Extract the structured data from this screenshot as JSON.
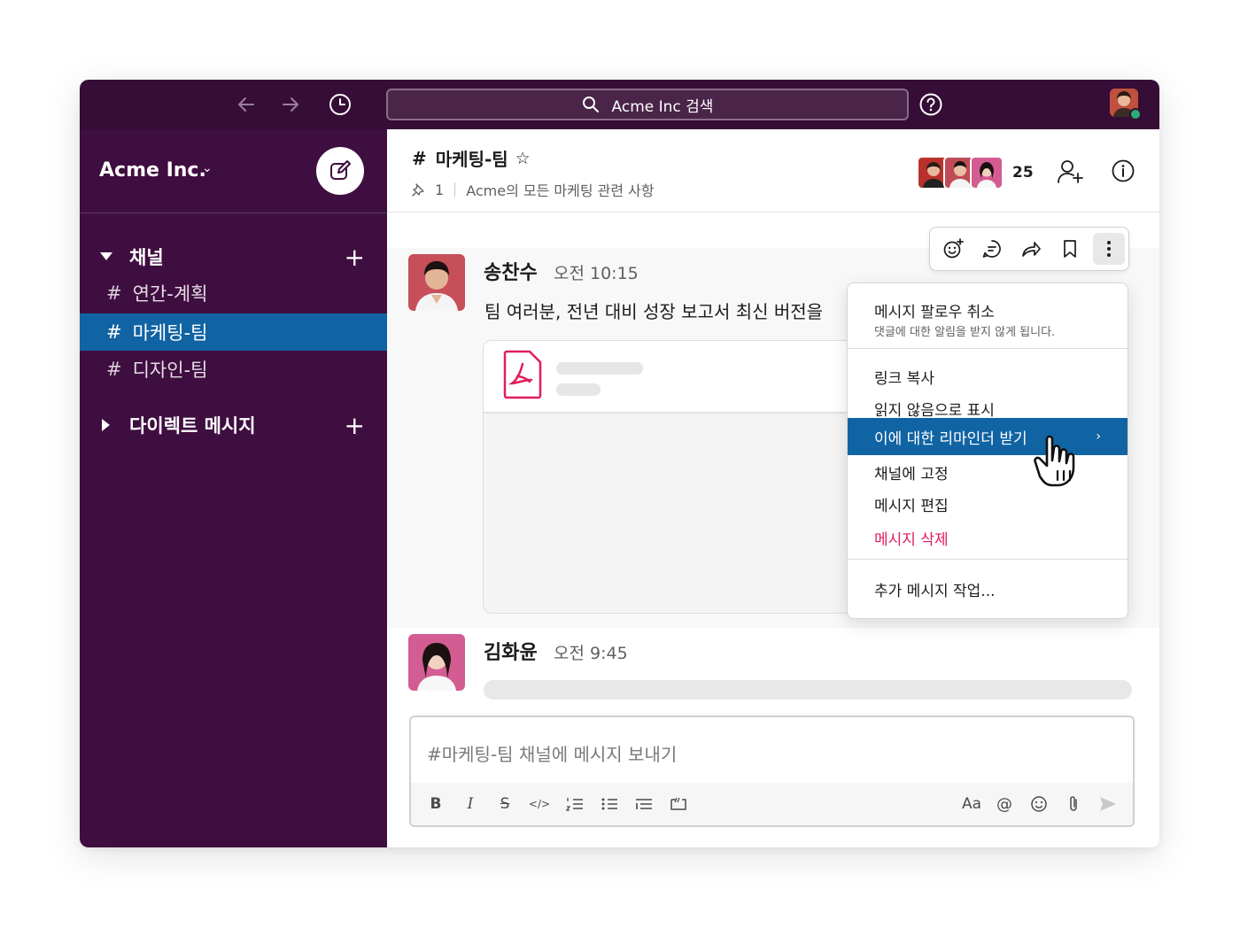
{
  "topbar": {
    "search_text": "Acme Inc 검색",
    "back_icon": "arrow-left-icon",
    "forward_icon": "arrow-right-icon",
    "history_icon": "clock-icon",
    "help_icon": "question-icon",
    "presence_color": "#2bac76"
  },
  "sidebar": {
    "workspace_name": "Acme Inc.",
    "workspace_chevron": "⌄",
    "channels_header": "채널",
    "channels": [
      {
        "hash": "#",
        "name": "연간-계획"
      },
      {
        "hash": "#",
        "name": "마케팅-팀"
      },
      {
        "hash": "#",
        "name": "디자인-팀"
      }
    ],
    "dm_header": "다이렉트 메시지",
    "plus": "+",
    "bg_color": "#3f0e40",
    "active_color": "#1164a3"
  },
  "channel": {
    "hash": "#",
    "name": "마케팅-팀",
    "star": "☆",
    "pin_count": "1",
    "topic": "Acme의 모든 마케팅 관련 사항",
    "member_count": "25"
  },
  "messages": [
    {
      "sender": "송찬수",
      "time": "오전 10:15",
      "text": "팀 여러분, 전년 대비 성장 보고서 최신 버전을"
    },
    {
      "sender": "김화윤",
      "time": "오전 9:45"
    }
  ],
  "composer": {
    "placeholder": "#마케팅-팀 채널에 메시지 보내기",
    "bold": "B",
    "italic": "I",
    "strike": "S",
    "code": "</>",
    "font": "Aa",
    "mention": "@"
  },
  "context_menu": {
    "unfollow_title": "메시지 팔로우 취소",
    "unfollow_sub": "댓글에 대한 알림을 받지 않게 됩니다.",
    "items": [
      "링크 복사",
      "읽지 않음으로 표시",
      "이에 대한 리마인더 받기",
      "채널에 고정",
      "메시지 편집",
      "메시지 삭제"
    ],
    "more": "추가 메시지 작업...",
    "submenu_arrow": "›",
    "danger_color": "#e01e5a"
  }
}
